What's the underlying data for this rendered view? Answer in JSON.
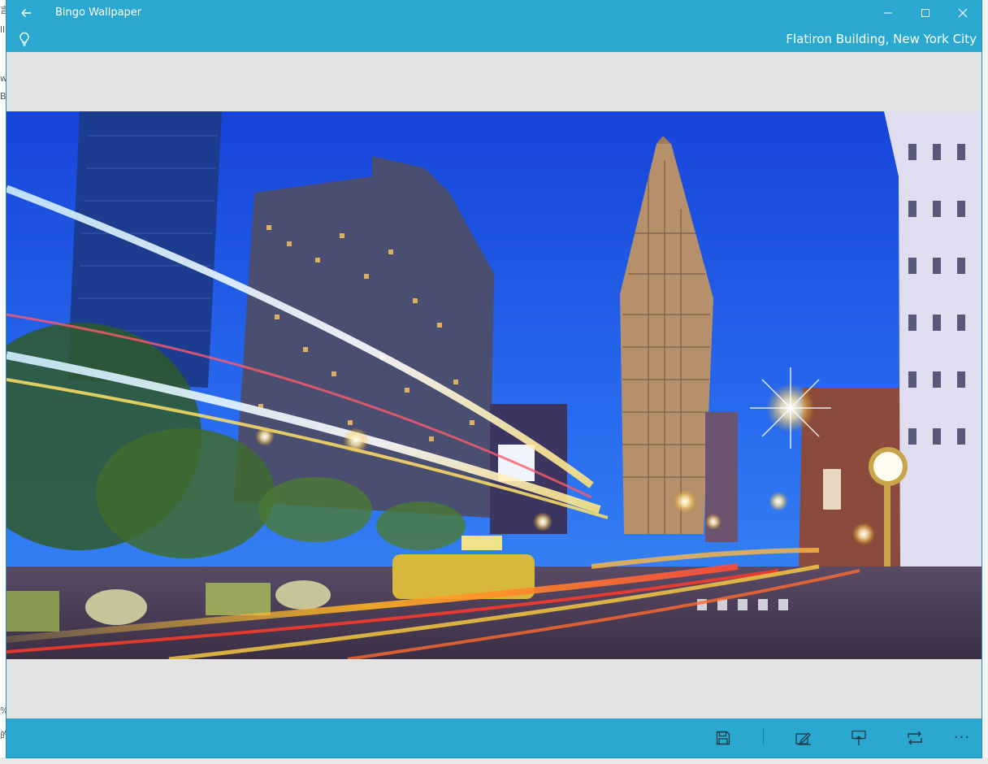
{
  "window": {
    "title": "Bingo Wallpaper",
    "back_icon": "back-arrow-icon",
    "minimize_icon": "minimize-icon",
    "maximize_icon": "maximize-icon",
    "close_icon": "close-icon"
  },
  "header": {
    "tip_icon": "lightbulb-icon",
    "location_title": "Flatiron Building, New York City"
  },
  "wallpaper": {
    "subject": "Flatiron Building at dusk with light trails"
  },
  "commands": {
    "save_icon": "save-icon",
    "edit_icon": "edit-icon",
    "pin_icon": "pin-icon",
    "repeat_icon": "repeat-icon",
    "more_label": "···"
  },
  "colors": {
    "accent": "#2aa8cf",
    "canvas": "#e3e3e3",
    "sky": "#1f58e0"
  }
}
